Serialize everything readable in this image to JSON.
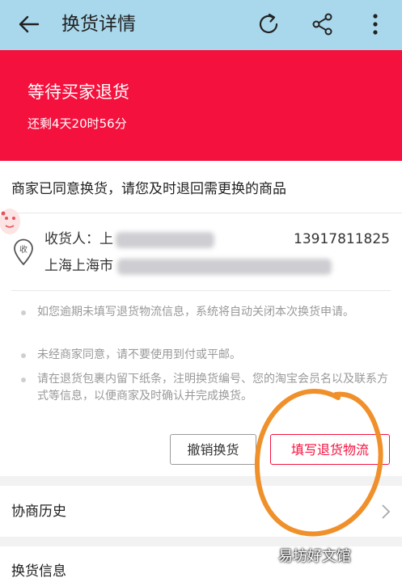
{
  "appbar": {
    "title": "换货详情",
    "icons": [
      "back-arrow-icon",
      "refresh-icon",
      "share-icon",
      "more-icon"
    ]
  },
  "status": {
    "heading": "等待买家退货",
    "countdown": "还剩4天20时56分"
  },
  "card": {
    "notice": "商家已同意换货，请您及时退回需更换的商品",
    "address_icon_label": "收",
    "receiver": "收货人：上",
    "phone": "13917811825",
    "address": "上海上海市",
    "tips": [
      "如您逾期未填写退货物流信息，系统将自动关闭本次换货申请。",
      "未经商家同意，请不要使用到付或平邮。",
      "请在退货包裹内留下纸条，注明换货编号、您的淘宝会员名以及联系方式等信息，以便商家及时确认并完成换货。"
    ],
    "buttons": {
      "cancel": "撤销换货",
      "fill_logistics": "填写退货物流"
    }
  },
  "sections": {
    "history": "协商历史",
    "exchange_info": "换货信息"
  },
  "watermark": "易坊好文馆",
  "colors": {
    "appbar_bg": "#a9d8ec",
    "status_bg": "#f5113e",
    "accent": "#f5113e",
    "annotation": "#f0902a"
  }
}
